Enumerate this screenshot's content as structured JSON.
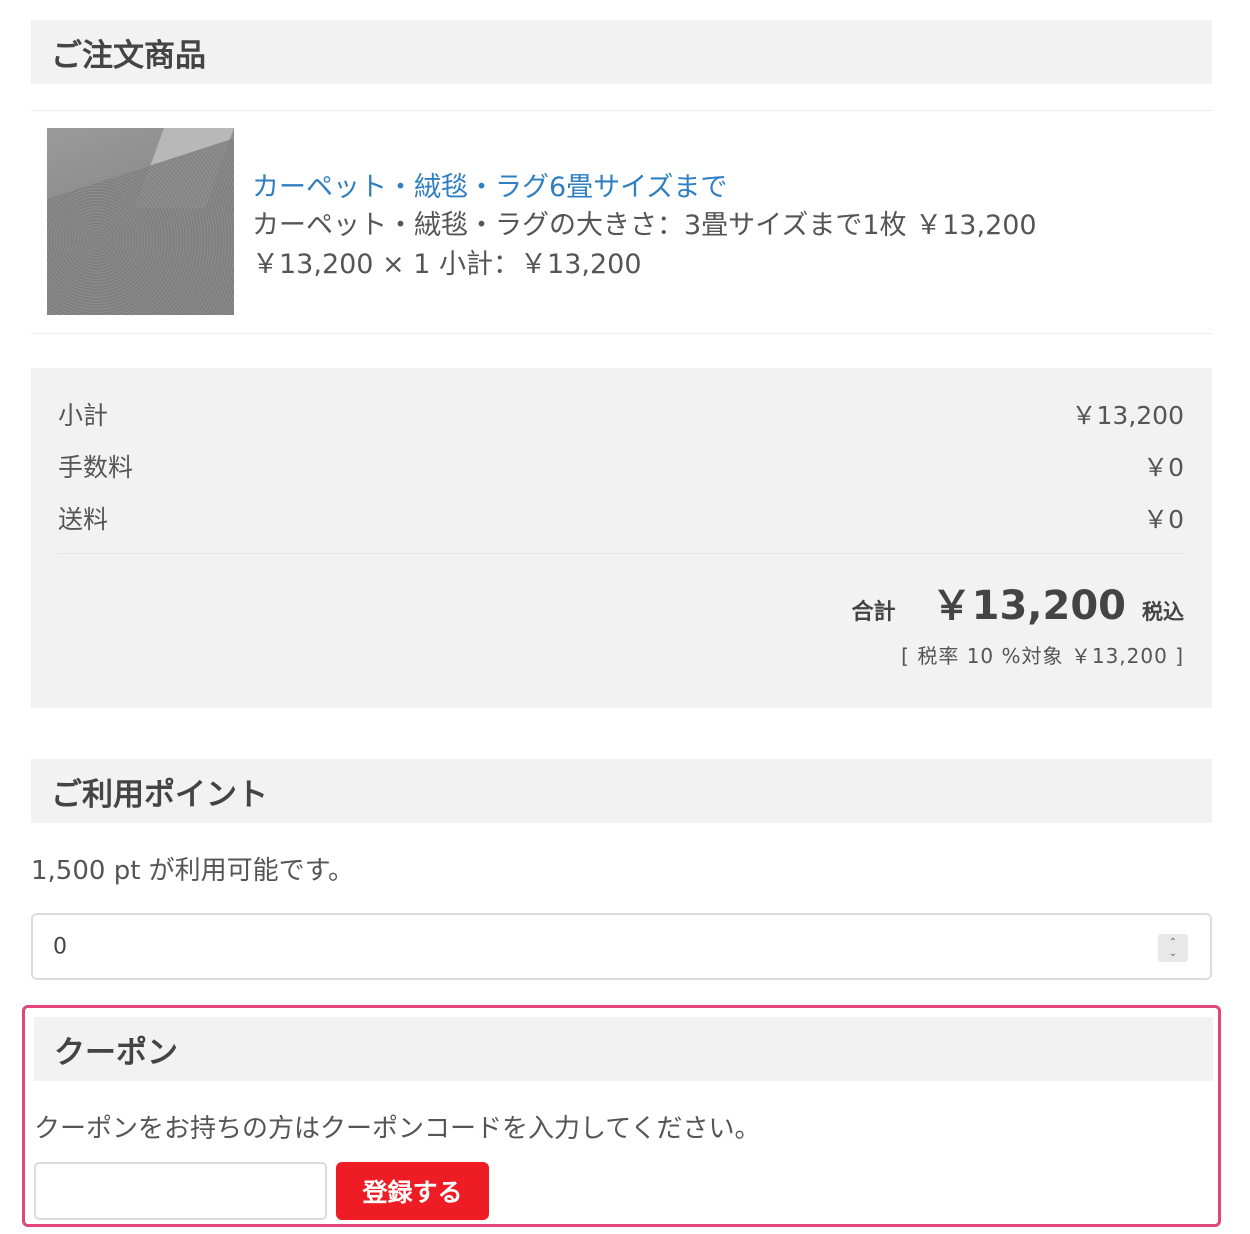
{
  "order_items": {
    "header": "ご注文商品",
    "item": {
      "name": "カーペット・絨毯・ラグ6畳サイズまで",
      "option_line": "カーペット・絨毯・ラグの大きさ：3畳サイズまで1枚 ￥13,200",
      "price_line": "￥13,200 × 1  小計：￥13,200"
    }
  },
  "totals": {
    "subtotal_label": "小計",
    "subtotal_value": "￥13,200",
    "fee_label": "手数料",
    "fee_value": "￥0",
    "shipping_label": "送料",
    "shipping_value": "￥0",
    "total_label": "合計",
    "total_value": "￥13,200",
    "tax_included": "税込",
    "tax_note": "[ 税率 10 %対象  ￥13,200 ]"
  },
  "points": {
    "header": "ご利用ポイント",
    "available_text": "1,500 pt が利用可能です。",
    "input_value": "0"
  },
  "coupon": {
    "header": "クーポン",
    "instruction": "クーポンをお持ちの方はクーポンコードを入力してください。",
    "input_value": "",
    "register_label": "登録する",
    "highlight_color": "#e0457b",
    "button_color": "#ee1c25"
  }
}
